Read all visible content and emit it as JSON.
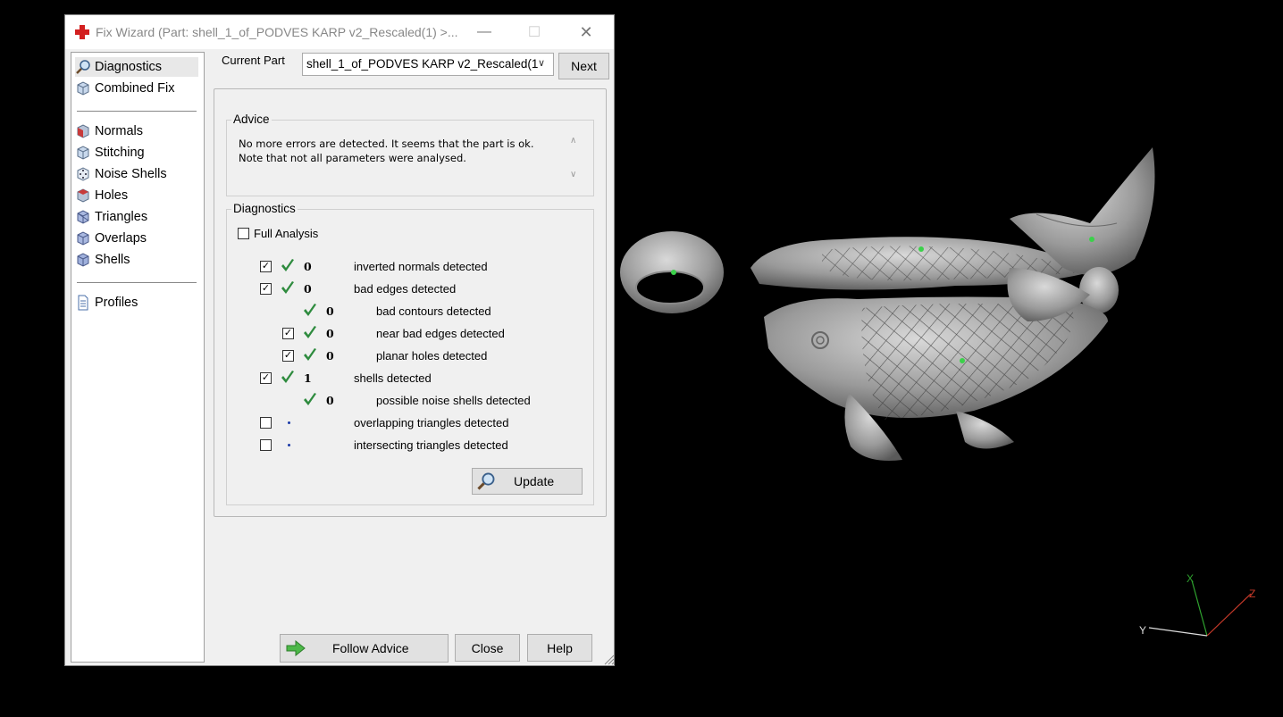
{
  "window": {
    "title": "Fix Wizard (Part: shell_1_of_PODVES KARP v2_Rescaled(1) >...",
    "minimize_glyph": "—",
    "maximize_glyph": "☐",
    "close_glyph": "✕"
  },
  "nav": {
    "items": [
      {
        "label": "Diagnostics",
        "icon": "magnifier-icon"
      },
      {
        "label": "Combined Fix",
        "icon": "cube-icon"
      },
      {
        "label": "Normals",
        "icon": "cube-red-icon"
      },
      {
        "label": "Stitching",
        "icon": "cube-icon"
      },
      {
        "label": "Noise Shells",
        "icon": "dice-icon"
      },
      {
        "label": "Holes",
        "icon": "cube-red-icon"
      },
      {
        "label": "Triangles",
        "icon": "cube-blue-icon"
      },
      {
        "label": "Overlaps",
        "icon": "cube-blue-icon"
      },
      {
        "label": "Shells",
        "icon": "cube-blue-icon"
      },
      {
        "label": "Profiles",
        "icon": "document-icon"
      }
    ]
  },
  "header": {
    "current_part_label": "Current Part",
    "current_part_value": "shell_1_of_PODVES KARP v2_Rescaled(1",
    "next_label": "Next"
  },
  "advice": {
    "label": "Advice",
    "text": "No more errors are detected. It seems that the part is ok. Note that not all parameters were analysed."
  },
  "diagnostics": {
    "label": "Diagnostics",
    "full_analysis_label": "Full Analysis",
    "rows": [
      {
        "checked": true,
        "status": "ok",
        "value": "0",
        "label": "inverted normals detected",
        "level": 0
      },
      {
        "checked": true,
        "status": "ok",
        "value": "0",
        "label": "bad edges detected",
        "level": 0
      },
      {
        "checked": null,
        "status": "ok",
        "value": "0",
        "label": "bad contours detected",
        "level": 1
      },
      {
        "checked": true,
        "status": "ok",
        "value": "0",
        "label": "near bad edges detected",
        "level": 1
      },
      {
        "checked": true,
        "status": "ok",
        "value": "0",
        "label": "planar holes detected",
        "level": 1
      },
      {
        "checked": true,
        "status": "ok",
        "value": "1",
        "label": "shells detected",
        "level": 0
      },
      {
        "checked": null,
        "status": "ok",
        "value": "0",
        "label": "possible noise shells detected",
        "level": 1
      },
      {
        "checked": false,
        "status": "unknown",
        "value": "",
        "label": "overlapping triangles detected",
        "level": 0
      },
      {
        "checked": false,
        "status": "unknown",
        "value": "",
        "label": "intersecting triangles detected",
        "level": 0
      }
    ],
    "update_label": "Update"
  },
  "footer": {
    "follow_advice_label": "Follow Advice",
    "close_label": "Close",
    "help_label": "Help"
  },
  "viewport": {
    "axis_x": "X",
    "axis_y": "Y",
    "axis_z": "Z"
  },
  "colors": {
    "check_green": "#2e8b3e",
    "model_gray": "#a8a8a8",
    "background": "#000000"
  }
}
